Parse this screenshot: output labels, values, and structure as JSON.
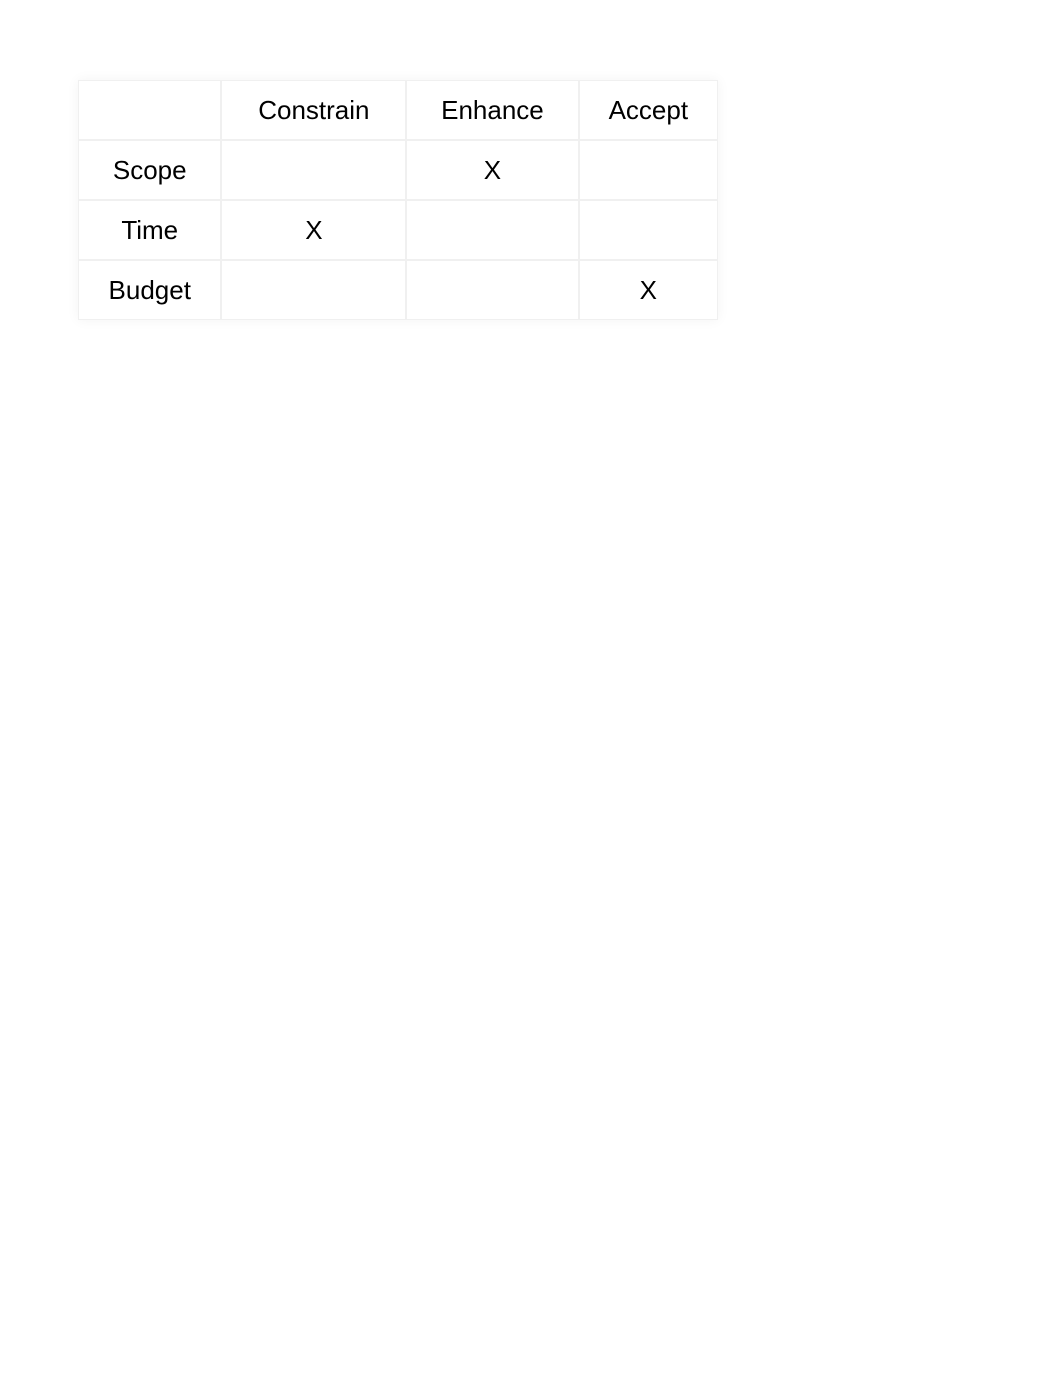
{
  "chart_data": {
    "type": "table",
    "columns": [
      "Constrain",
      "Enhance",
      "Accept"
    ],
    "rows": [
      "Scope",
      "Time",
      "Budget"
    ],
    "cells": [
      [
        "",
        "X",
        ""
      ],
      [
        "X",
        "",
        ""
      ],
      [
        "",
        "",
        "X"
      ]
    ]
  }
}
